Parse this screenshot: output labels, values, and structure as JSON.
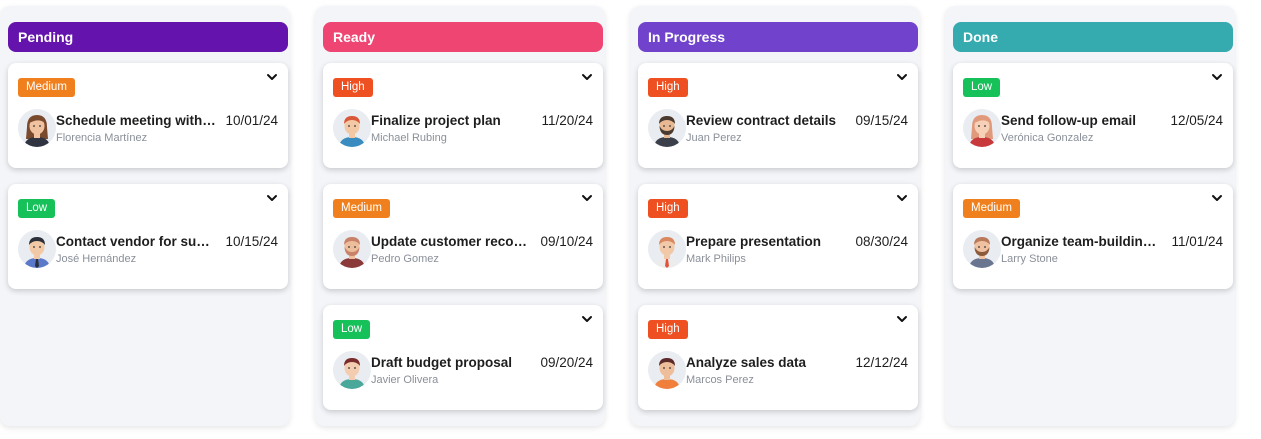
{
  "colors": {
    "medium": "#f0801e",
    "high": "#ee5021",
    "low": "#17c15a"
  },
  "columns": [
    {
      "title": "Pending",
      "color": "#6414ad",
      "cards": [
        {
          "priority": "Medium",
          "title": "Schedule meeting with client",
          "assignee": "Florencia Martínez",
          "date": "10/01/24",
          "avatar": "female-brown-hair-avatar"
        },
        {
          "priority": "Low",
          "title": "Contact vendor for supplies",
          "assignee": "José Hernández",
          "date": "10/15/24",
          "avatar": "male-suit-avatar"
        }
      ]
    },
    {
      "title": "Ready",
      "color": "#ef4573",
      "cards": [
        {
          "priority": "High",
          "title": "Finalize project plan",
          "assignee": "Michael Rubing",
          "date": "11/20/24",
          "avatar": "male-red-hair-avatar"
        },
        {
          "priority": "Medium",
          "title": "Update customer records",
          "assignee": "Pedro Gomez",
          "date": "09/10/24",
          "avatar": "male-bald-avatar"
        },
        {
          "priority": "Low",
          "title": "Draft budget proposal",
          "assignee": "Javier Olivera",
          "date": "09/20/24",
          "avatar": "male-dark-hair-avatar"
        }
      ]
    },
    {
      "title": "In Progress",
      "color": "#7143cc",
      "cards": [
        {
          "priority": "High",
          "title": "Review contract details",
          "assignee": "Juan Perez",
          "date": "09/15/24",
          "avatar": "male-beard-avatar"
        },
        {
          "priority": "High",
          "title": "Prepare presentation",
          "assignee": "Mark Philips",
          "date": "08/30/24",
          "avatar": "male-tie-avatar"
        },
        {
          "priority": "High",
          "title": "Analyze sales data",
          "assignee": "Marcos Perez",
          "date": "12/12/24",
          "avatar": "male-orange-shirt-avatar"
        }
      ]
    },
    {
      "title": "Done",
      "color": "#35abb0",
      "cards": [
        {
          "priority": "Low",
          "title": "Send follow-up email",
          "assignee": "Verónica Gonzalez",
          "date": "12/05/24",
          "avatar": "female-red-hair-avatar"
        },
        {
          "priority": "Medium",
          "title": "Organize team-building event",
          "assignee": "Larry Stone",
          "date": "11/01/24",
          "avatar": "male-mustache-avatar"
        }
      ]
    }
  ]
}
